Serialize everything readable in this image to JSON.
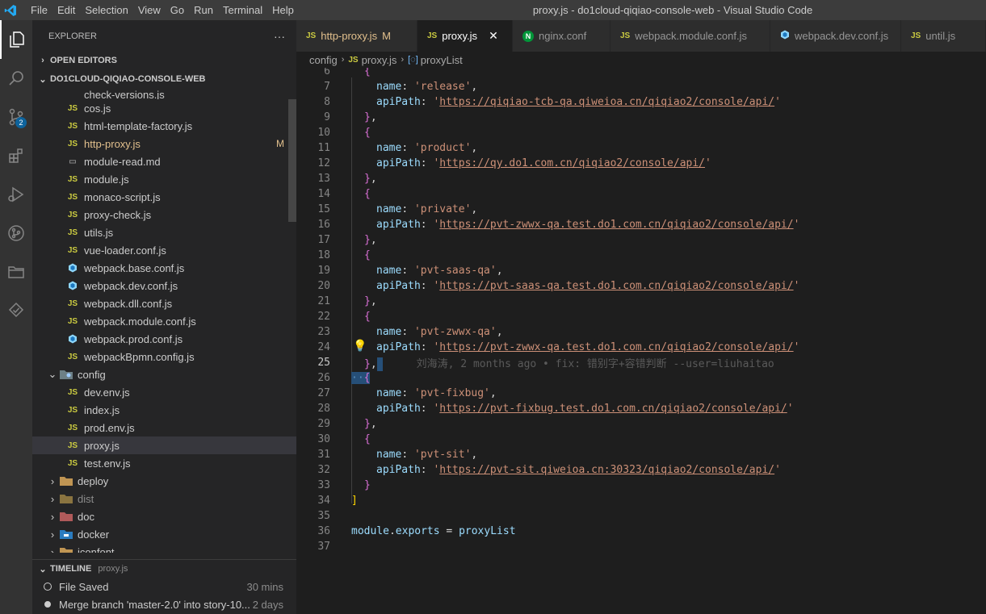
{
  "menu": [
    "File",
    "Edit",
    "Selection",
    "View",
    "Go",
    "Run",
    "Terminal",
    "Help"
  ],
  "window_title": "proxy.js - do1cloud-qiqiao-console-web - Visual Studio Code",
  "activity": {
    "scm_badge": "2"
  },
  "explorer": {
    "header": "EXPLORER",
    "more": "···",
    "open_editors": "OPEN EDITORS",
    "project": "DO1CLOUD-QIQIAO-CONSOLE-WEB",
    "partial_file": "check-versions.js",
    "files": [
      {
        "name": "cos.js",
        "icon": "JS"
      },
      {
        "name": "html-template-factory.js",
        "icon": "JS"
      },
      {
        "name": "http-proxy.js",
        "icon": "JS",
        "flag": "M"
      },
      {
        "name": "module-read.md",
        "icon": "MD"
      },
      {
        "name": "module.js",
        "icon": "JS"
      },
      {
        "name": "monaco-script.js",
        "icon": "JS"
      },
      {
        "name": "proxy-check.js",
        "icon": "JS"
      },
      {
        "name": "utils.js",
        "icon": "JS"
      },
      {
        "name": "vue-loader.conf.js",
        "icon": "JS"
      },
      {
        "name": "webpack.base.conf.js",
        "icon": "webpack"
      },
      {
        "name": "webpack.dev.conf.js",
        "icon": "webpack"
      },
      {
        "name": "webpack.dll.conf.js",
        "icon": "JS"
      },
      {
        "name": "webpack.module.conf.js",
        "icon": "JS"
      },
      {
        "name": "webpack.prod.conf.js",
        "icon": "webpack"
      },
      {
        "name": "webpackBpmn.config.js",
        "icon": "JS"
      }
    ],
    "config_folder": "config",
    "config_files": [
      "dev.env.js",
      "index.js",
      "prod.env.js",
      "proxy.js",
      "test.env.js"
    ],
    "folders": [
      "deploy",
      "dist",
      "doc",
      "docker",
      "iconfont"
    ]
  },
  "timeline": {
    "title": "TIMELINE",
    "file": "proxy.js",
    "items": [
      {
        "label": "File Saved",
        "when": "30 mins"
      },
      {
        "label": "Merge branch 'master-2.0' into story-10...",
        "when": "2 days"
      }
    ]
  },
  "tabs": [
    {
      "label": "http-proxy.js",
      "flag": "M",
      "icon": "JS"
    },
    {
      "label": "proxy.js",
      "icon": "JS",
      "close": "✕"
    },
    {
      "label": "nginx.conf",
      "icon": "N"
    },
    {
      "label": "webpack.module.conf.js",
      "icon": "JS"
    },
    {
      "label": "webpack.dev.conf.js",
      "icon": "webpack"
    },
    {
      "label": "until.js",
      "icon": "JS"
    }
  ],
  "breadcrumb": {
    "folder": "config",
    "file": "proxy.js",
    "symbol": "proxyList"
  },
  "editor": {
    "lines": {
      "6": "{",
      "7_key": "name",
      "7_val": "'release'",
      "8_key": "apiPath",
      "8_val": "https://qiqiao-tcb-qa.qiweioa.cn/qiqiao2/console/api/",
      "11_val": "'product'",
      "12_val": "https://qy.do1.com.cn/qiqiao2/console/api/",
      "15_val": "'private'",
      "16_val": "https://pvt-zwwx-qa.test.do1.com.cn/qiqiao2/console/api/",
      "19_val": "'pvt-saas-qa'",
      "20_val": "https://pvt-saas-qa.test.do1.com.cn/qiqiao2/console/api/",
      "23_val": "'pvt-zwwx-qa'",
      "24_val": "https://pvt-zwwx-qa.test.do1.com.cn/qiqiao2/console/api/",
      "25_blame": "刘海涛, 2 months ago • fix: 错别字+容错判断 --user=liuhaitao",
      "27_val": "'pvt-fixbug'",
      "28_val": "https://pvt-fixbug.test.do1.com.cn/qiqiao2/console/api/",
      "31_val": "'pvt-sit'",
      "32_val": "https://pvt-sit.qiweioa.cn:30323/qiqiao2/console/api/",
      "36_module": "module",
      "36_exports": "exports",
      "36_rhs": "proxyList"
    },
    "current_line": "25"
  }
}
